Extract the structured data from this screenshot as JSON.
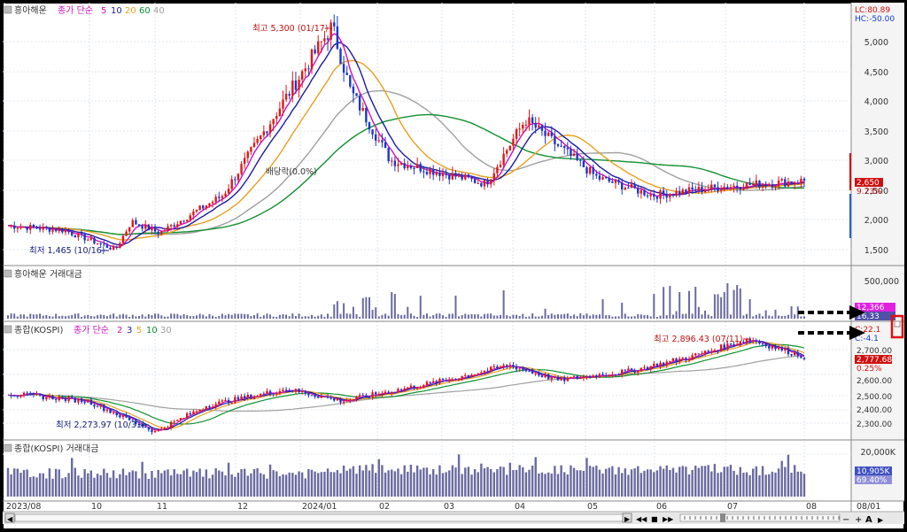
{
  "panels": {
    "price": {
      "title": "흥아해운",
      "ma_label": "종가 단순",
      "ma_periods": [
        "5",
        "10",
        "20",
        "60",
        "40"
      ],
      "ma_colors": [
        "#d010c0",
        "#1c1ca0",
        "#e8a020",
        "#109030",
        "#a0a0a0"
      ],
      "lc": "LC:80.89",
      "hc": "HC:-50.00",
      "max_label": "최고 5,300 (01/17)",
      "min_label": "최저 1,465 (10/16)",
      "dividend_label": "배당락(0.0%)",
      "last_price": "2,650",
      "change_pct": "9.73%",
      "y_ticks": [
        "5,000",
        "4,500",
        "4,000",
        "3,500",
        "3,000",
        "2,500",
        "2,000",
        "1,500"
      ]
    },
    "price_volume": {
      "title": "흥아해운 거래대금",
      "y_ticks": [
        "500,000"
      ],
      "value1": "12,366",
      "value2": "16,33"
    },
    "kospi": {
      "title": "종합(KOSPI)",
      "ma_label": "종가 단순",
      "ma_periods": [
        "2",
        "3",
        "5",
        "10",
        "30"
      ],
      "ma_colors": [
        "#d010c0",
        "#1c1ca0",
        "#e8a020",
        "#109030",
        "#a0a0a0"
      ],
      "lc": "C:22.1",
      "hc": "C:-4.1",
      "max_label": "최고 2,896.43 (07/11)",
      "min_label": "최저 2,273.97 (10/31)",
      "last_value": "2,777.68",
      "change_pct": "0.25%",
      "y_ticks": [
        "2,700.00",
        "2,600.00",
        "2,500.00",
        "2,400.00",
        "2,300.00"
      ]
    },
    "kospi_volume": {
      "title": "종합(KOSPI) 거래대금",
      "y_ticks": [
        "20,000K"
      ],
      "value1": "10,905K",
      "value2": "69.40%"
    }
  },
  "x_axis": {
    "labels": [
      "2023/08",
      "10",
      "11",
      "12",
      "2024/01",
      "02",
      "03",
      "04",
      "05",
      "06",
      "07",
      "08"
    ],
    "right_label": "08/01"
  },
  "controls": {
    "buttons": [
      "◀",
      "▶",
      "◀◀",
      "■",
      "▶▶",
      "−",
      "+",
      "A",
      "▶"
    ]
  },
  "chart_data": {
    "type": "candlestick",
    "title": "흥아해운",
    "x_start": "2023/08",
    "x_end": "2024/08",
    "ylim": [
      1300,
      5400
    ],
    "price_series": [
      {
        "date": "2023/08",
        "close": 1880
      },
      {
        "date": "2023/09",
        "close": 1800
      },
      {
        "date": "2023/10/16",
        "close": 1465
      },
      {
        "date": "2023/10",
        "close": 1950
      },
      {
        "date": "2023/11",
        "close": 1750
      },
      {
        "date": "2023/12",
        "close": 2400
      },
      {
        "date": "2024/01/17",
        "close": 5300
      },
      {
        "date": "2024/01",
        "close": 4200
      },
      {
        "date": "2024/02",
        "close": 3000
      },
      {
        "date": "2024/03",
        "close": 2600
      },
      {
        "date": "2024/04",
        "close": 3700
      },
      {
        "date": "2024/05",
        "close": 2700
      },
      {
        "date": "2024/06",
        "close": 2400
      },
      {
        "date": "2024/07",
        "close": 2550
      },
      {
        "date": "2024/08",
        "close": 2650
      }
    ],
    "kospi_series": [
      {
        "date": "2023/08",
        "close": 2530
      },
      {
        "date": "2023/09",
        "close": 2480
      },
      {
        "date": "2023/10/31",
        "close": 2273.97
      },
      {
        "date": "2023/11",
        "close": 2450
      },
      {
        "date": "2023/12",
        "close": 2560
      },
      {
        "date": "2024/01",
        "close": 2480
      },
      {
        "date": "2024/02",
        "close": 2620
      },
      {
        "date": "2024/03",
        "close": 2720
      },
      {
        "date": "2024/04",
        "close": 2620
      },
      {
        "date": "2024/05",
        "close": 2680
      },
      {
        "date": "2024/06",
        "close": 2780
      },
      {
        "date": "2024/07/11",
        "close": 2896.43
      },
      {
        "date": "2024/08",
        "close": 2777.68
      }
    ]
  }
}
